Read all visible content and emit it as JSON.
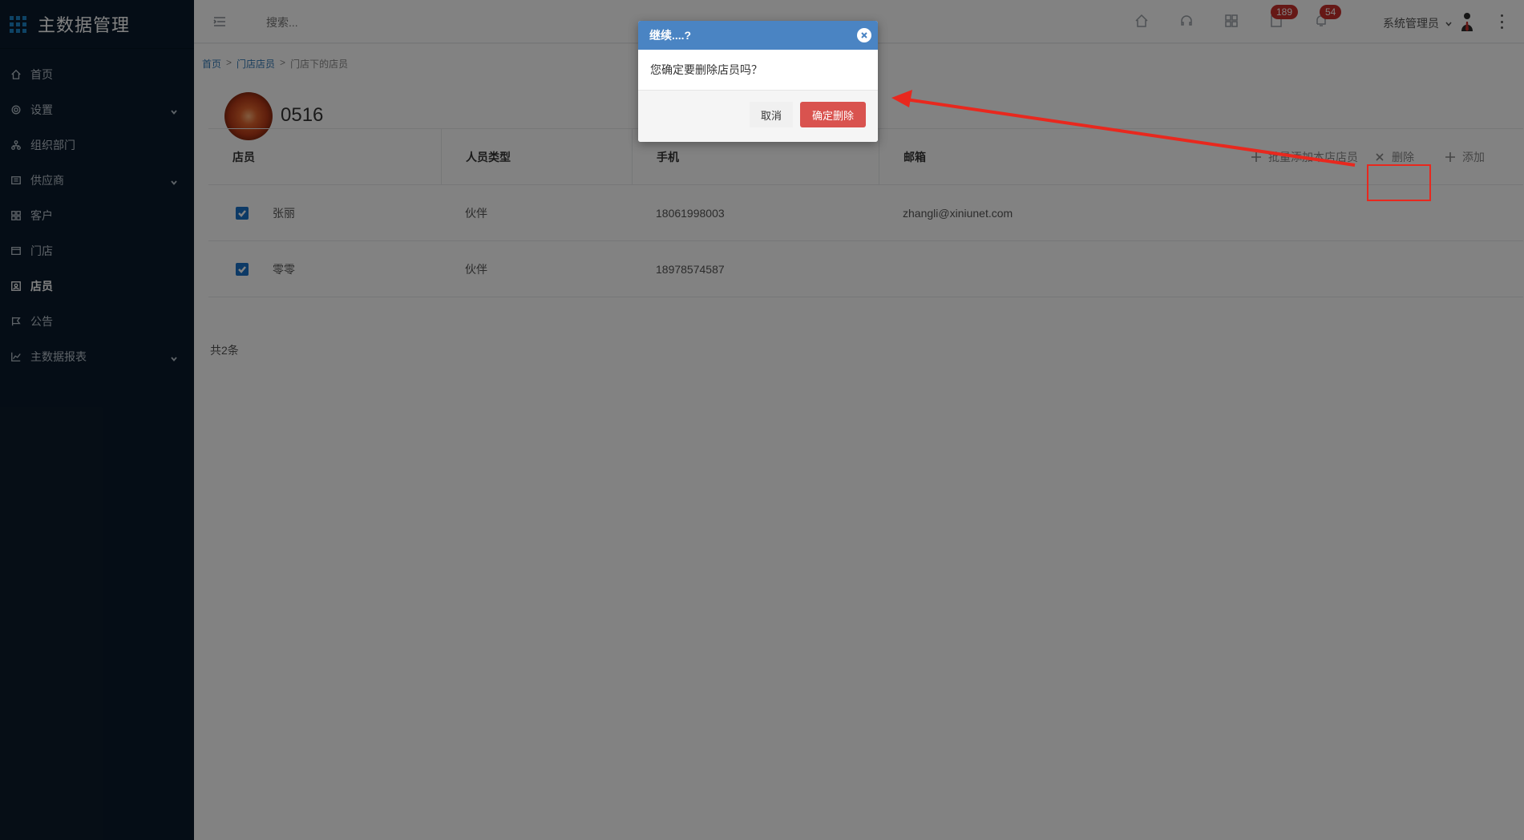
{
  "app": {
    "title": "主数据管理"
  },
  "sidebar": {
    "items": [
      {
        "label": "首页",
        "icon": "home-icon",
        "has_children": false,
        "active": false
      },
      {
        "label": "设置",
        "icon": "gear-icon",
        "has_children": true,
        "active": false
      },
      {
        "label": "组织部门",
        "icon": "org-icon",
        "has_children": false,
        "active": false
      },
      {
        "label": "供应商",
        "icon": "supplier-icon",
        "has_children": true,
        "active": false
      },
      {
        "label": "客户",
        "icon": "customer-icon",
        "has_children": false,
        "active": false
      },
      {
        "label": "门店",
        "icon": "store-icon",
        "has_children": false,
        "active": false
      },
      {
        "label": "店员",
        "icon": "clerk-icon",
        "has_children": false,
        "active": true
      },
      {
        "label": "公告",
        "icon": "announcement-icon",
        "has_children": false,
        "active": false
      },
      {
        "label": "主数据报表",
        "icon": "report-icon",
        "has_children": true,
        "active": false
      }
    ]
  },
  "header": {
    "search_placeholder": "搜索...",
    "badge_1": "189",
    "badge_2": "54",
    "user_name": "系统管理员"
  },
  "breadcrumb": {
    "home": "首页",
    "sep1": ">",
    "parent": "门店店员",
    "sep2": ">",
    "current": "门店下的店员"
  },
  "store": {
    "name": "0516"
  },
  "table": {
    "columns": [
      "店员",
      "人员类型",
      "手机",
      "邮箱"
    ],
    "rows": [
      {
        "checked": true,
        "name": "张丽",
        "type": "伙伴",
        "phone": "18061998003",
        "email": "zhangli@xiniunet.com"
      },
      {
        "checked": true,
        "name": "零零",
        "type": "伙伴",
        "phone": "18978574587",
        "email": ""
      }
    ],
    "actions": {
      "batch_add": "批量添加本店店员",
      "delete": "删除",
      "add": "添加"
    },
    "total": "共2条"
  },
  "modal": {
    "title": "继续....?",
    "message": "您确定要删除店员吗？",
    "cancel": "取消",
    "confirm": "确定删除"
  },
  "colors": {
    "sidebar_bg": "#0b1b2b",
    "modal_header": "#4a84c3",
    "confirm_button": "#d9534f",
    "annotation_red": "#e8281e",
    "badge_red": "#c9302c",
    "checkbox_blue": "#1a73c8"
  }
}
